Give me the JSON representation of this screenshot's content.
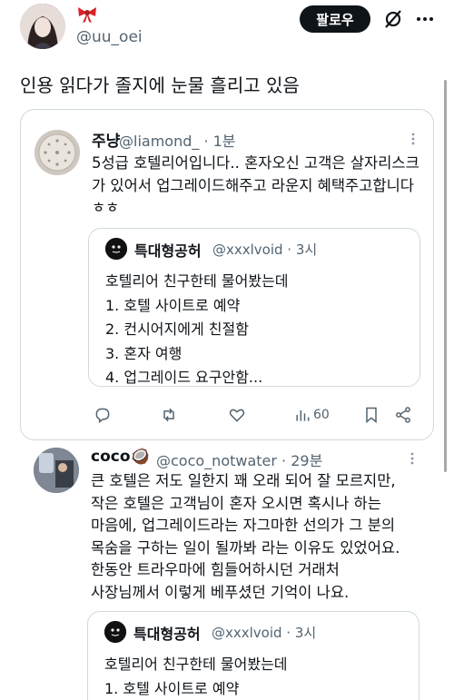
{
  "header": {
    "handle": "@uu_oei",
    "follow_label": "팔로우",
    "icons": {
      "bow": "bow-icon",
      "grok": "grok-icon",
      "more": "more-icon"
    },
    "accent": "#0f1419"
  },
  "post": {
    "text": "인용 읽다가 졸지에 눈물 흘리고 있음"
  },
  "quote": {
    "name": "주냥",
    "handle": "@liamond_ · 1분",
    "text": "5성급 호텔리어입니다.. 혼자오신 고객은 살자리스크가 있어서 업그레이드해주고 라운지 혜택주고합니다 ㅎㅎ",
    "nested": {
      "name": "특대형공허",
      "handle": "@xxxlvoid · 3시",
      "lines": [
        "호텔리어 친구한테 물어봤는데",
        "1. 호텔 사이트로 예약",
        "2. 컨시어지에게 친절함",
        "3. 혼자 여행",
        "4. 업그레이드 요구안함..."
      ]
    },
    "actions": {
      "views": "60"
    }
  },
  "reply": {
    "name": "coco🥥",
    "handle": "@coco_notwater · 29분",
    "lines": [
      "큰 호텔은 저도 일한지 꽤 오래 되어 잘 모르지만,",
      "작은 호텔은 고객님이 혼자 오시면 혹시나 하는",
      "마음에, 업그레이드라는 자그마한 선의가 그 분의",
      "목숨을 구하는 일이 될까봐 라는 이유도 있었어요.",
      "한동안 트라우마에 힘들어하시던 거래처",
      "사장님께서 이렇게 베푸셨던 기억이 나요."
    ],
    "nested": {
      "name": "특대형공허",
      "handle": "@xxxlvoid · 3시",
      "lines": [
        "호텔리어 친구한테 물어봤는데",
        "1. 호텔 사이트로 예약"
      ]
    }
  }
}
